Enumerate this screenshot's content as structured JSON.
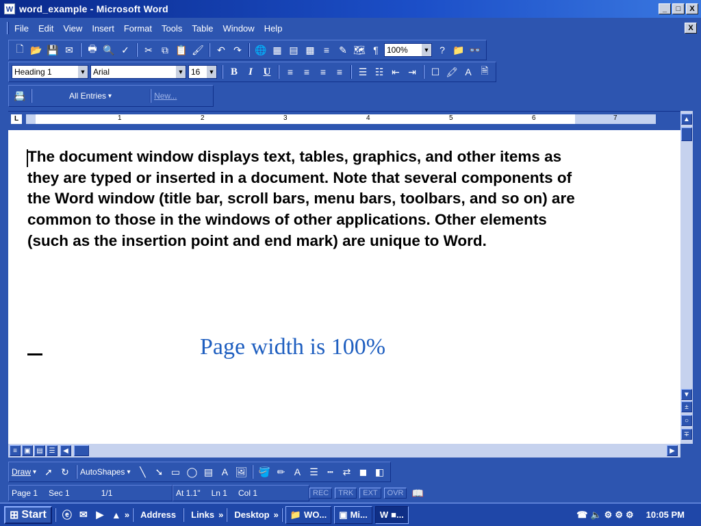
{
  "window": {
    "title": "word_example - Microsoft Word",
    "controls": [
      "_",
      "□",
      "X"
    ]
  },
  "menu": {
    "items": [
      "File",
      "Edit",
      "View",
      "Insert",
      "Format",
      "Tools",
      "Table",
      "Window",
      "Help"
    ],
    "close": "X"
  },
  "standard_toolbar": {
    "zoom": "100%"
  },
  "formatting_toolbar": {
    "style": "Heading 1",
    "font": "Arial",
    "size": "16",
    "bold": "B",
    "italic": "I",
    "underline": "U"
  },
  "autotext_toolbar": {
    "entries": "All Entries",
    "new": "New..."
  },
  "ruler": {
    "corner": "L",
    "ticks": [
      "1",
      "2",
      "3",
      "4",
      "5",
      "6",
      "7"
    ]
  },
  "document": {
    "body": "The document window displays text, tables, graphics, and other items as they are typed or inserted in a document. Note that several components of the Word window (title bar, scroll bars, menu bars, toolbars, and so on) are common to those in the windows of other applications. Other elements (such as the insertion point and end mark) are unique to Word.",
    "caption": "Page width is 100%"
  },
  "drawing_toolbar": {
    "draw": "Draw",
    "autoshapes": "AutoShapes"
  },
  "status": {
    "page": "Page 1",
    "sec": "Sec 1",
    "pages": "1/1",
    "at": "At 1.1\"",
    "ln": "Ln 1",
    "col": "Col 1",
    "rec": "REC",
    "trk": "TRK",
    "ext": "EXT",
    "ovr": "OVR"
  },
  "taskbar": {
    "start": "Start",
    "address": "Address",
    "links": "Links",
    "desktop": "Desktop",
    "tasks": [
      "WO...",
      "Mi...",
      "■..."
    ],
    "clock": "10:05 PM"
  }
}
